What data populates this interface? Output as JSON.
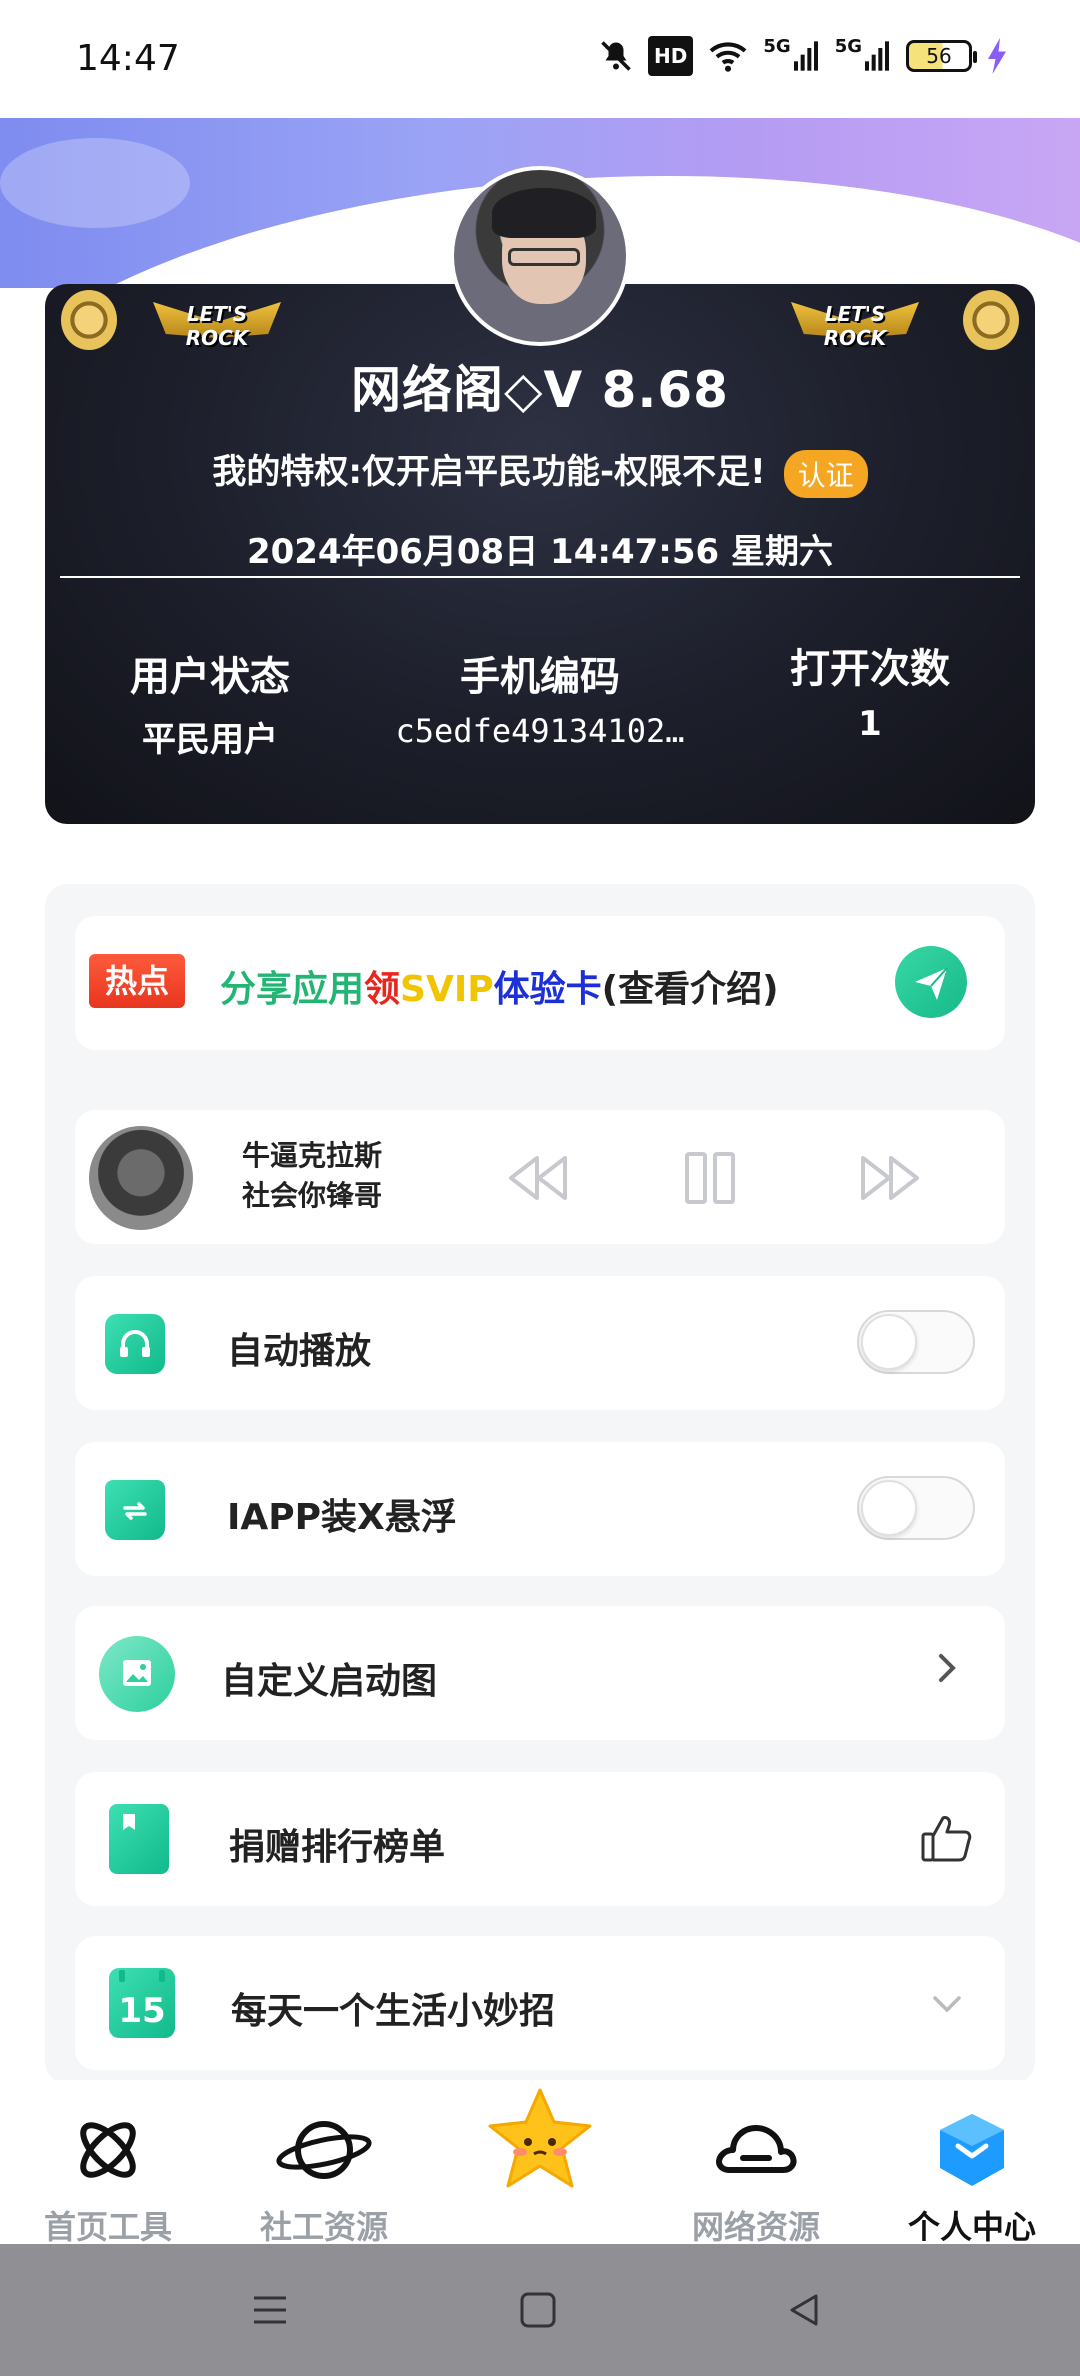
{
  "status_bar": {
    "time": "14:47",
    "hd_label": "HD",
    "network_1": "5G",
    "network_2": "5G",
    "battery_level": "56",
    "icons": [
      "bell-muted-icon",
      "hd-icon",
      "wifi-icon",
      "signal-5g-icon",
      "signal-5g-icon",
      "battery-icon",
      "charging-bolt-icon"
    ]
  },
  "card": {
    "title": "网络阁◇V 8.68",
    "privilege": "我的特权:仅开启平民功能-权限不足!",
    "verify_badge": "认证",
    "datetime": "2024年06月08日 14:47:56 星期六",
    "decoration_text": "LET'S ROCK",
    "stats": [
      {
        "label": "用户状态",
        "value": "平民用户"
      },
      {
        "label": "手机编码",
        "value": "c5edfe49134102…"
      },
      {
        "label": "打开次数",
        "value": "1"
      }
    ]
  },
  "share_row": {
    "hot_tag": "热点",
    "parts": [
      {
        "text": "分享应用",
        "color": "#22b573"
      },
      {
        "text": "领",
        "color": "#e8261e"
      },
      {
        "text": "SVIP",
        "color": "#f0c400"
      },
      {
        "text": "体验卡",
        "color": "#1d2fd6"
      },
      {
        "text": "(查看介绍)",
        "color": "#222222"
      }
    ]
  },
  "music": {
    "song": "牛逼克拉斯",
    "artist": "社会你锋哥"
  },
  "settings": [
    {
      "label": "自动播放",
      "control": "toggle",
      "on": false,
      "icon": "headphones-icon"
    },
    {
      "label": "IAPP装X悬浮",
      "control": "toggle",
      "on": false,
      "icon": "folder-swap-icon"
    },
    {
      "label": "自定义启动图",
      "control": "chevron",
      "icon": "image-icon"
    },
    {
      "label": "捐赠排行榜单",
      "control": "thumb",
      "icon": "bookmark-icon"
    },
    {
      "label": "每天一个生活小妙招",
      "control": "chevron-down",
      "icon": "calendar-icon",
      "calendar_day": "15"
    }
  ],
  "bottom_nav": [
    {
      "label": "首页工具",
      "icon": "atom-icon",
      "active": false
    },
    {
      "label": "社工资源",
      "icon": "planet-icon",
      "active": false
    },
    {
      "label": "",
      "icon": "star-mascot-icon",
      "active": false
    },
    {
      "label": "网络资源",
      "icon": "cloud-icon",
      "active": false
    },
    {
      "label": "个人中心",
      "icon": "profile-cube-icon",
      "active": true
    }
  ],
  "colors": {
    "accent_green": "#17b98a",
    "badge_orange": "#f5a623",
    "card_dark": "#1c1e2a",
    "header_gradient_start": "#7f8cf0",
    "header_gradient_end": "#c8a6f4"
  }
}
